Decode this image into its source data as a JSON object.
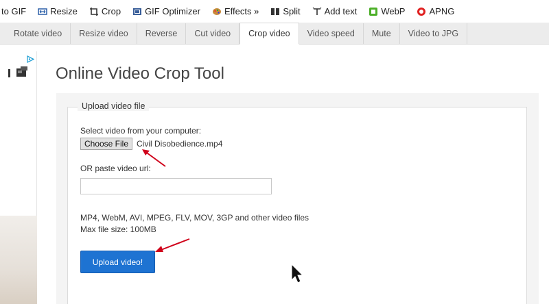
{
  "top_nav": [
    {
      "label": "to GIF",
      "icon": "none"
    },
    {
      "label": "Resize",
      "icon": "resize-icon"
    },
    {
      "label": "Crop",
      "icon": "crop-icon"
    },
    {
      "label": "GIF Optimizer",
      "icon": "optimizer-icon"
    },
    {
      "label": "Effects »",
      "icon": "effects-icon"
    },
    {
      "label": "Split",
      "icon": "split-icon"
    },
    {
      "label": "Add text",
      "icon": "add-text-icon"
    },
    {
      "label": "WebP",
      "icon": "webp-icon"
    },
    {
      "label": "APNG",
      "icon": "apng-icon"
    }
  ],
  "sub_tabs": [
    {
      "label": "Rotate video"
    },
    {
      "label": "Resize video"
    },
    {
      "label": "Reverse"
    },
    {
      "label": "Cut video"
    },
    {
      "label": "Crop video",
      "active": true
    },
    {
      "label": "Video speed"
    },
    {
      "label": "Mute"
    },
    {
      "label": "Video to JPG"
    }
  ],
  "page": {
    "title": "Online Video Crop Tool"
  },
  "upload": {
    "legend": "Upload video file",
    "select_label": "Select video from your computer:",
    "choose_button": "Choose File",
    "chosen_file": "Civil Disobedience.mp4",
    "url_label": "OR paste video url:",
    "url_value": "",
    "formats_text": "MP4, WebM, AVI, MPEG, FLV, MOV, 3GP and other video files",
    "max_size_text": "Max file size: 100MB",
    "upload_button": "Upload video!"
  },
  "colors": {
    "accent_blue": "#1e73d2",
    "annotation_red": "#d0021b",
    "webp_green": "#4caf28",
    "apng_red": "#e02020"
  }
}
